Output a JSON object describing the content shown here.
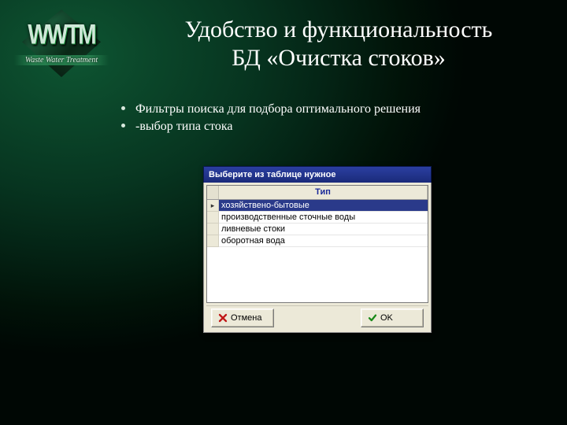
{
  "logo": {
    "word": "WWTM",
    "subtitle": "Waste Water Treatment"
  },
  "title_line1": "Удобство и функциональность",
  "title_line2": "БД «Очистка стоков»",
  "bullets": [
    "Фильтры поиска для подбора оптимального решения",
    "-выбор типа стока"
  ],
  "dialog": {
    "title": "Выберите из таблице нужное",
    "column": "Тип",
    "rows": [
      "хозяйствено-бытовые",
      "производственные сточные воды",
      "ливневые стоки",
      "оборотная вода"
    ],
    "selected_index": 0,
    "cancel_label": "Отмена",
    "ok_label": "OK"
  }
}
